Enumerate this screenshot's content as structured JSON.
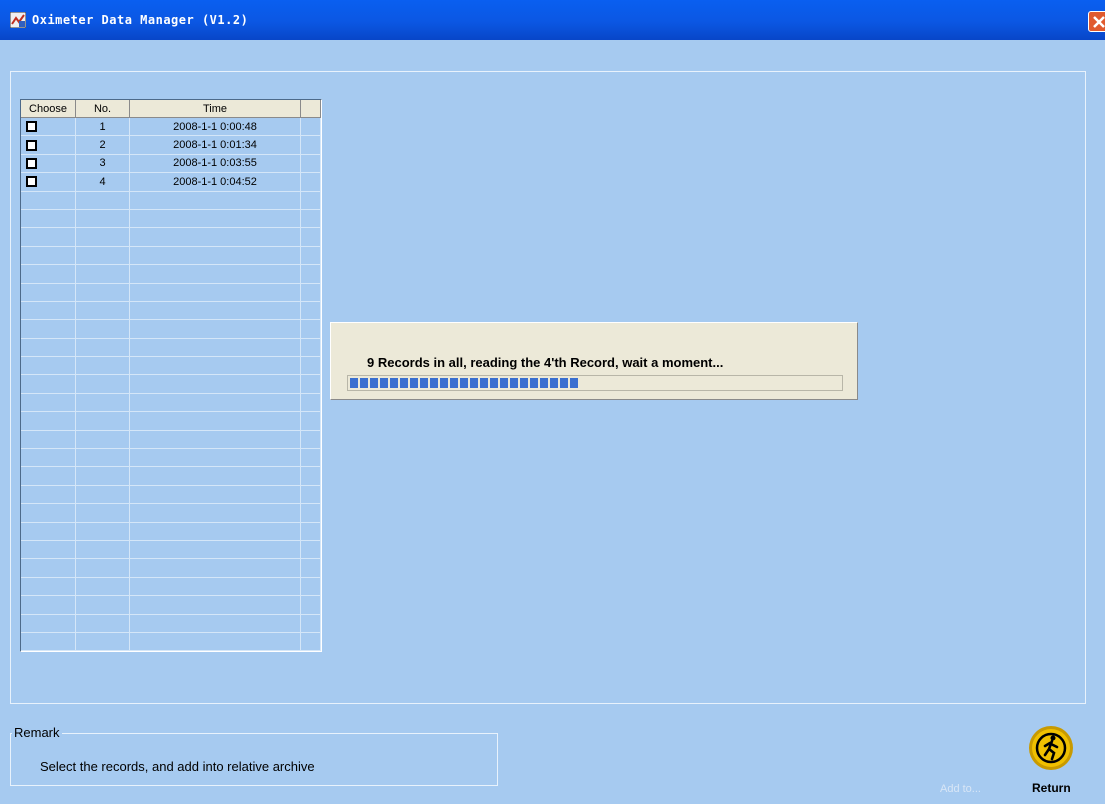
{
  "window": {
    "title": "Oximeter Data Manager (V1.2)"
  },
  "table": {
    "headers": {
      "choose": "Choose",
      "no": "No.",
      "time": "Time"
    },
    "rows": [
      {
        "no": "1",
        "time": "2008-1-1 0:00:48",
        "checked": false
      },
      {
        "no": "2",
        "time": "2008-1-1 0:01:34",
        "checked": false
      },
      {
        "no": "3",
        "time": "2008-1-1 0:03:55",
        "checked": false
      },
      {
        "no": "4",
        "time": "2008-1-1 0:04:52",
        "checked": false
      }
    ]
  },
  "progress_dialog": {
    "message": "9 Records in all, reading the 4'th Record, wait a moment...",
    "progress_fraction": 0.46
  },
  "remark": {
    "title": "Remark",
    "text": "Select the records, and add into relative archive"
  },
  "buttons": {
    "add_to_label": "Add to...",
    "return_label": "Return"
  },
  "colors": {
    "background": "#a6caf0",
    "titlebar": "#0b57e3",
    "progress": "#3a6fd0",
    "return_icon": "#e8b400"
  },
  "icons": {
    "app": "oximeter-app-icon",
    "close": "close-icon",
    "return": "running-man-icon"
  }
}
